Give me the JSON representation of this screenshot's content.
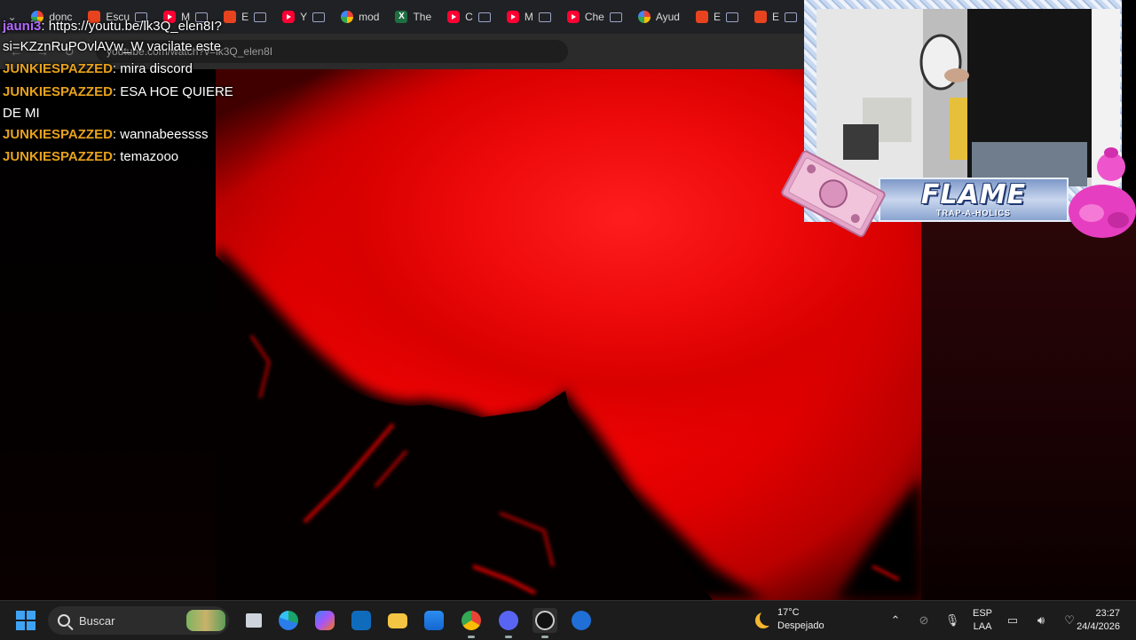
{
  "browser": {
    "tabs": [
      {
        "label": "donc",
        "icon": "google-icon",
        "kind": "g"
      },
      {
        "label": "Escu",
        "icon": "red-app-icon",
        "kind": "red"
      },
      {
        "label": "M",
        "icon": "youtube-icon",
        "kind": "yt"
      },
      {
        "label": "E",
        "icon": "red-app-icon",
        "kind": "red"
      },
      {
        "label": "Y",
        "icon": "youtube-icon",
        "kind": "yt"
      },
      {
        "label": "mod",
        "icon": "google-icon",
        "kind": "g"
      },
      {
        "label": "The",
        "icon": "sheet-icon",
        "kind": "xls"
      },
      {
        "label": "C",
        "icon": "youtube-icon",
        "kind": "yt"
      },
      {
        "label": "M",
        "icon": "youtube-icon",
        "kind": "yt"
      },
      {
        "label": "Che",
        "icon": "youtube-icon",
        "kind": "yt"
      },
      {
        "label": "Ayud",
        "icon": "google-icon",
        "kind": "g"
      },
      {
        "label": "E",
        "icon": "red-app-icon",
        "kind": "red"
      },
      {
        "label": "E",
        "icon": "red-app-icon",
        "kind": "red"
      }
    ],
    "url": "youtube.com/watch?v=lk3Q_elen8I"
  },
  "chat": {
    "messages": [
      {
        "user": "jauni3",
        "text": "https://youtu.be/lk3Q_elen8I?si=KZznRuPOvlAVw_W  vacilate este",
        "color": "#b36bff"
      },
      {
        "user": "JUNKIESPAZZED",
        "text": "mira discord",
        "color": "#e8a21c"
      },
      {
        "user": "JUNKIESPAZZED",
        "text": "ESA HOE QUIERE DE MI",
        "color": "#e8a21c"
      },
      {
        "user": "JUNKIESPAZZED",
        "text": "wannabeessss",
        "color": "#e8a21c"
      },
      {
        "user": "JUNKIESPAZZED",
        "text": "temazooo",
        "color": "#e8a21c"
      }
    ],
    "separator": ": "
  },
  "overlay": {
    "banner_title": "FLAME",
    "banner_subtitle": "TRAP-A-HOLICS"
  },
  "taskbar": {
    "search_placeholder": "Buscar",
    "weather_temp": "17°C",
    "weather_desc": "Despejado",
    "lang_top": "ESP",
    "lang_bottom": "LAA",
    "time": "23:27",
    "date": "24/4/2026"
  },
  "colors": {
    "video_red": "#e00000",
    "taskbar_bg": "#1c1c1c",
    "accent_blue": "#3fa3f5"
  }
}
